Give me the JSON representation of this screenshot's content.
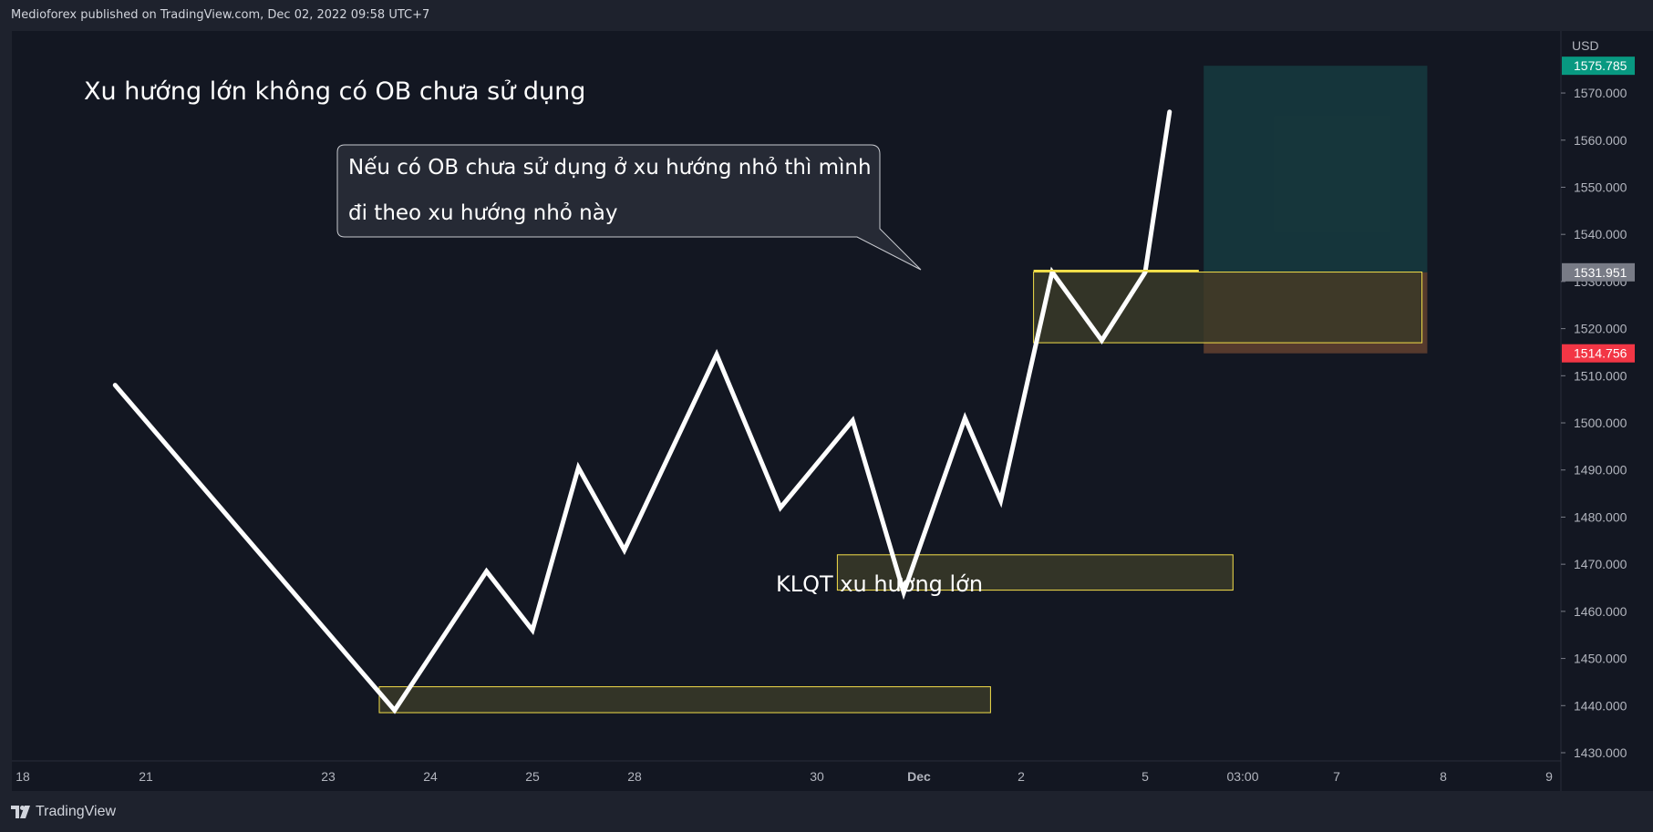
{
  "header": {
    "published_text": "Medioforex published on TradingView.com, Dec 02, 2022 09:58 UTC+7"
  },
  "footer": {
    "logo_text": "TradingView"
  },
  "colors": {
    "background": "#131722",
    "line": "#ffffff",
    "zone_fill": "#3a3a28",
    "zone_border": "#f5e04a",
    "target_fill": "#163b3f",
    "stop_fill": "#5e3e2f",
    "badge_target": "#089981",
    "badge_stop": "#f23645",
    "badge_current": "#787b86"
  },
  "chart_data": {
    "type": "line",
    "title": "Xu hướng lớn không có OB chưa sử dụng",
    "currency": "USD",
    "ylim": [
      1425,
      1582
    ],
    "y_ticks": [
      1430,
      1440,
      1450,
      1460,
      1470,
      1480,
      1490,
      1500,
      1510,
      1520,
      1530,
      1540,
      1550,
      1560,
      1570
    ],
    "y_tick_labels": [
      "1430.000",
      "1440.000",
      "1450.000",
      "1460.000",
      "1470.000",
      "1480.000",
      "1490.000",
      "1500.000",
      "1510.000",
      "1520.000",
      "1530.000",
      "1540.000",
      "1550.000",
      "1560.000",
      "1570.000"
    ],
    "x_tick_labels": [
      "18",
      "21",
      "23",
      "24",
      "25",
      "28",
      "30",
      "Dec",
      "2",
      "5",
      "03:00",
      "7",
      "8",
      "9"
    ],
    "price_badges": [
      {
        "label": "1575.785",
        "value": 1575.785,
        "kind": "target"
      },
      {
        "label": "1531.951",
        "value": 1531.951,
        "kind": "current"
      },
      {
        "label": "1514.756",
        "value": 1514.756,
        "kind": "stop"
      }
    ],
    "series": [
      {
        "values": [
          {
            "x": 0.75,
            "y": 1508
          },
          {
            "x": 2.65,
            "y": 1439
          },
          {
            "x": 3.55,
            "y": 1468.5
          },
          {
            "x": 4.0,
            "y": 1456
          },
          {
            "x": 4.45,
            "y": 1490.5
          },
          {
            "x": 4.9,
            "y": 1473
          },
          {
            "x": 5.45,
            "y": 1514.5
          },
          {
            "x": 5.8,
            "y": 1482
          },
          {
            "x": 6.35,
            "y": 1500.5
          },
          {
            "x": 6.85,
            "y": 1464
          },
          {
            "x": 7.45,
            "y": 1501
          },
          {
            "x": 7.8,
            "y": 1483.5
          },
          {
            "x": 8.25,
            "y": 1532
          },
          {
            "x": 8.65,
            "y": 1517.5
          },
          {
            "x": 9.0,
            "y": 1531.951
          },
          {
            "x": 9.25,
            "y": 1566
          }
        ]
      }
    ],
    "zones": [
      {
        "x0": 2.5,
        "x1": 7.7,
        "y0": 1438.5,
        "y1": 1444
      },
      {
        "x0": 6.2,
        "x1": 9.9,
        "y0": 1464.5,
        "y1": 1472
      },
      {
        "x0": 8.1,
        "x1": 11.8,
        "y0": 1517,
        "y1": 1532
      }
    ],
    "position": {
      "x0": 9.6,
      "x1": 11.85,
      "entry": 1531.951,
      "target": 1575.785,
      "stop": 1514.756
    },
    "hline": {
      "x0": 8.1,
      "x1": 9.55,
      "y": 1532.3
    },
    "annotations": {
      "zone_label": "KLQT xu hướng lớn",
      "callout_line1": "Nếu có OB chưa sử dụng ở xu hướng nhỏ thì mình",
      "callout_line2": "đi theo xu hướng nhỏ này"
    }
  }
}
